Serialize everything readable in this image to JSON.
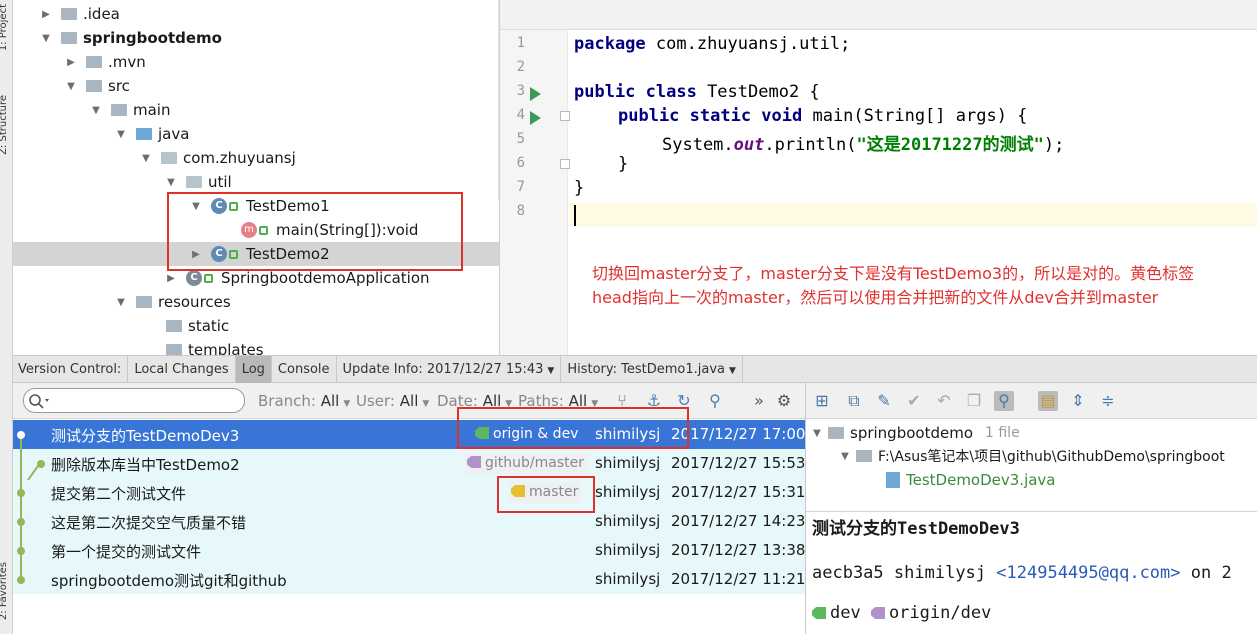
{
  "tool_strip": {
    "top_label": "1: Project",
    "mid_label": "Z: Structure",
    "bottom_label": "2: Favorites"
  },
  "project_tree": {
    "rows": [
      {
        "label": "",
        "arrow": "▶"
      },
      {
        "label": ".idea",
        "arrow": "▶"
      },
      {
        "label": "springbootdemo",
        "arrow": "▼"
      },
      {
        "label": ".mvn",
        "arrow": "▶"
      },
      {
        "label": "src",
        "arrow": "▼"
      },
      {
        "label": "main",
        "arrow": "▼"
      },
      {
        "label": "java",
        "arrow": "▼"
      },
      {
        "label": "com.zhuyuansj",
        "arrow": "▼"
      },
      {
        "label": "util",
        "arrow": "▼"
      },
      {
        "label": "TestDemo1",
        "arrow": "▼"
      },
      {
        "label": "main(String[]):void",
        "arrow": ""
      },
      {
        "label": "TestDemo2",
        "arrow": "▶"
      },
      {
        "label": "SpringbootdemoApplication",
        "arrow": "▶"
      },
      {
        "label": "resources",
        "arrow": "▼"
      },
      {
        "label": "static",
        "arrow": ""
      },
      {
        "label": "templates",
        "arrow": ""
      }
    ]
  },
  "editor": {
    "line_numbers": [
      "1",
      "2",
      "3",
      "4",
      "5",
      "6",
      "7",
      "8"
    ],
    "code": {
      "l1_kw": "package",
      "l1_rest": " com.zhuyuansj.util;",
      "l3_kw": "public class",
      "l3_rest": " TestDemo2 {",
      "l4_kw": "public static void",
      "l4_rest": " main(String[] args) {",
      "l5_a": "System.",
      "l5_field": "out",
      "l5_b": ".println(",
      "l5_str": "\"这是20171227的测试\"",
      "l5_c": ");",
      "l6": "}",
      "l7": "}"
    }
  },
  "annotation": {
    "line1": "切换回master分支了，master分支下是没有TestDemo3的，所以是对的。黄色标签",
    "line2": "head指向上一次的master，然后可以使用合并把新的文件从dev合并到master"
  },
  "vc_tabs": {
    "title": "Version Control:",
    "tabs": [
      "Local Changes",
      "Log",
      "Console",
      "Update Info: 2017/12/27 15:43",
      "History: TestDemo1.java"
    ],
    "active": "Log"
  },
  "log_toolbar": {
    "search_placeholder": "",
    "branch": "Branch:",
    "branch_val": "All",
    "user": "User:",
    "user_val": "All",
    "date": "Date:",
    "date_val": "All",
    "paths": "Paths:",
    "paths_val": "All"
  },
  "commits": [
    {
      "message": "测试分支的TestDemoDev3",
      "ref": "origin & dev",
      "author": "shimilysj",
      "date": "2017/12/27 17:00"
    },
    {
      "message": "删除版本库当中TestDemo2",
      "ref": "github/master",
      "author": "shimilysj",
      "date": "2017/12/27 15:53"
    },
    {
      "message": "提交第二个测试文件",
      "ref": "master",
      "author": "shimilysj",
      "date": "2017/12/27 15:31"
    },
    {
      "message": "这是第二次提交空气质量不错",
      "ref": "",
      "author": "shimilysj",
      "date": "2017/12/27 14:23"
    },
    {
      "message": "第一个提交的测试文件",
      "ref": "",
      "author": "shimilysj",
      "date": "2017/12/27 13:38"
    },
    {
      "message": "springbootdemo测试git和github",
      "ref": "",
      "author": "shimilysj",
      "date": "2017/12/27 11:21"
    }
  ],
  "details": {
    "root_label": "springbootdemo",
    "root_count": "1 file",
    "path_label": "F:\\Asus笔记本\\项目\\github\\GithubDemo\\springboot",
    "file_label": "TestDemoDev3.java",
    "commit_title": "测试分支的TestDemoDev3",
    "hash": "aecb3a5",
    "author": "shimilysj",
    "email": "<124954495@qq.com>",
    "on": "on 2",
    "ref1": "dev",
    "ref2": "origin/dev"
  },
  "colors": {
    "selection": "#3875d6",
    "row_bg": "#e6f8fa",
    "annotation": "#e03030",
    "highlight_box": "#e0302a",
    "graph": "#95b65a"
  }
}
